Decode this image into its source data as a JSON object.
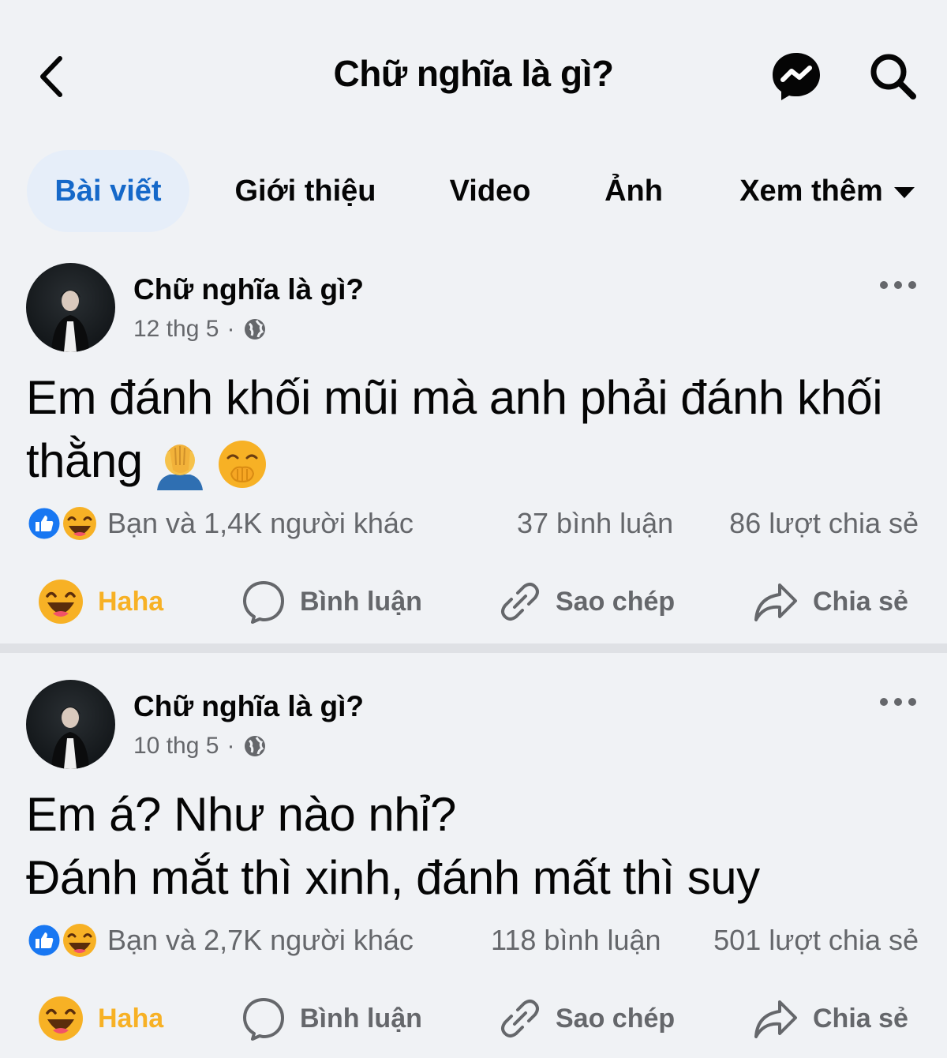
{
  "header": {
    "title": "Chữ nghĩa là gì?",
    "back_icon": "chevron-left-icon",
    "messenger_icon": "messenger-icon",
    "search_icon": "search-icon"
  },
  "tabs": [
    {
      "label": "Bài viết",
      "active": true
    },
    {
      "label": "Giới thiệu",
      "active": false
    },
    {
      "label": "Video",
      "active": false
    },
    {
      "label": "Ảnh",
      "active": false
    },
    {
      "label": "Xem thêm",
      "active": false,
      "has_dropdown": true
    }
  ],
  "posts": [
    {
      "author": "Chữ nghĩa là gì?",
      "date": "12 thg 5",
      "separator": "·",
      "privacy_icon": "globe-icon",
      "text_line1": "Em đánh khối mũi mà anh phải đánh khối",
      "text_line2": "thằng",
      "text_emojis": [
        "facepalm-emoji",
        "hand-over-mouth-emoji"
      ],
      "reactions_text": "Bạn và 1,4K người khác",
      "comments": "37 bình luận",
      "shares": "86 lượt chia sẻ",
      "actions": {
        "react": "Haha",
        "comment": "Bình luận",
        "copy": "Sao chép",
        "share": "Chia sẻ"
      }
    },
    {
      "author": "Chữ nghĩa là gì?",
      "date": "10 thg 5",
      "separator": "·",
      "privacy_icon": "globe-icon",
      "text_line1": "Em á? Như nào nhỉ?",
      "text_line2": "Đánh mắt thì xinh, đánh mất thì suy",
      "reactions_text": "Bạn và 2,7K người khác",
      "comments": "118 bình luận",
      "shares": "501 lượt chia sẻ",
      "actions": {
        "react": "Haha",
        "comment": "Bình luận",
        "copy": "Sao chép",
        "share": "Chia sẻ"
      }
    }
  ],
  "colors": {
    "background": "#f0f2f5",
    "active_tab_text": "#1568c9",
    "active_tab_bg": "#e6eef9",
    "secondary_text": "#65676b",
    "haha_yellow": "#f7b125",
    "like_blue": "#1877f2"
  }
}
